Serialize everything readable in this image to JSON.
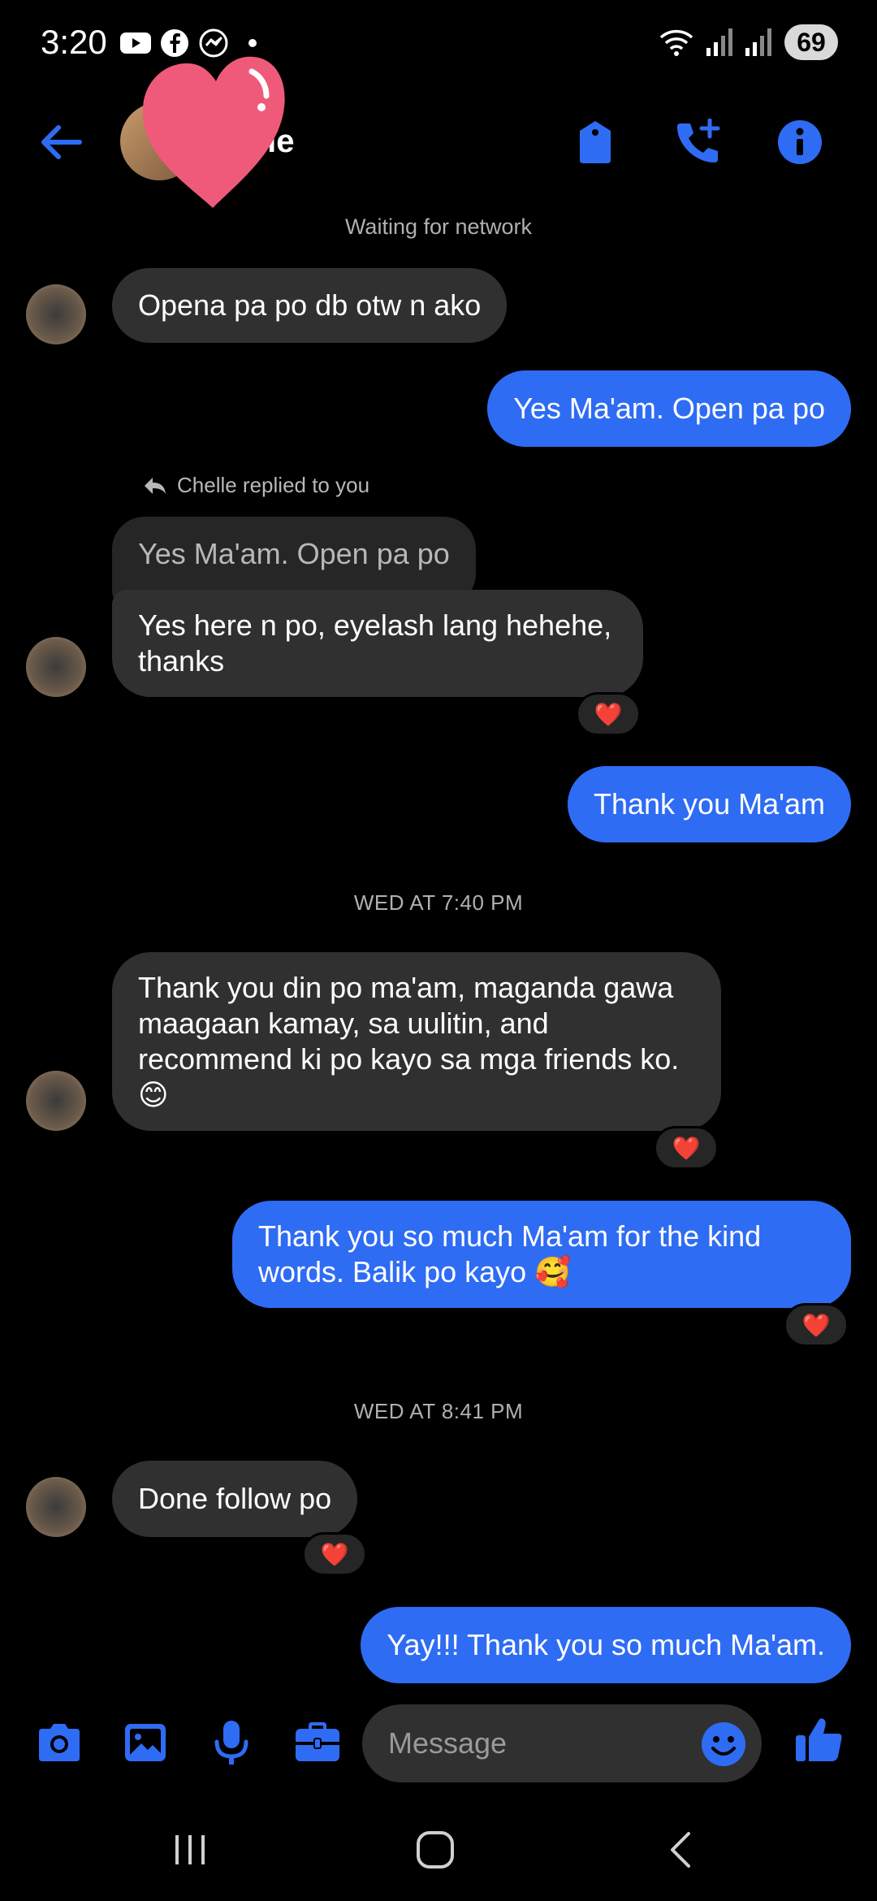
{
  "status_bar": {
    "time": "3:20",
    "battery": "69",
    "notification_icons": [
      "youtube-icon",
      "facebook-icon",
      "messenger-icon",
      "dot-icon"
    ],
    "system_icons": [
      "wifi-icon",
      "signal-icon",
      "signal-icon"
    ]
  },
  "header": {
    "contact_name": "lle",
    "buttons": [
      "back-arrow-icon",
      "tag-icon",
      "add-call-icon",
      "info-icon"
    ],
    "accent_color": "#2f6cf4",
    "sticker": "heart-sticker"
  },
  "network_status": "Waiting for network",
  "messages": [
    {
      "side": "in",
      "text": "Opena pa po db otw n ako"
    },
    {
      "side": "out",
      "text": "Yes Ma'am. Open pa po"
    },
    {
      "side": "in",
      "reply_note": "Chelle replied to you",
      "quoted": "Yes Ma'am. Open pa po",
      "text": "Yes here n po, eyelash lang hehehe, thanks",
      "reaction": "❤️"
    },
    {
      "side": "out",
      "text": "Thank you Ma'am"
    },
    {
      "side": "in",
      "text": "Thank you din po ma'am, maganda gawa maagaan kamay, sa uulitin, and recommend ki po kayo sa mga friends ko. 😊",
      "reaction": "❤️"
    },
    {
      "side": "out",
      "text": "Thank you so much Ma'am for the kind words. Balik po kayo 🥰",
      "reaction": "❤️"
    },
    {
      "side": "in",
      "text": "Done follow po",
      "reaction": "❤️"
    },
    {
      "side": "out",
      "text": "Yay!!! Thank you so much Ma'am."
    }
  ],
  "timestamps": [
    "WED AT 7:40 PM",
    "WED AT 8:41 PM"
  ],
  "composer": {
    "placeholder": "Message",
    "buttons": [
      "camera-icon",
      "gallery-icon",
      "microphone-icon",
      "briefcase-icon",
      "emoji-icon",
      "thumbs-up-icon"
    ]
  },
  "nav_bar": [
    "recents-icon",
    "home-icon",
    "back-icon"
  ],
  "colors": {
    "incoming_bubble": "#303030",
    "outgoing_bubble": "#2f6cf4",
    "background": "#000000"
  }
}
